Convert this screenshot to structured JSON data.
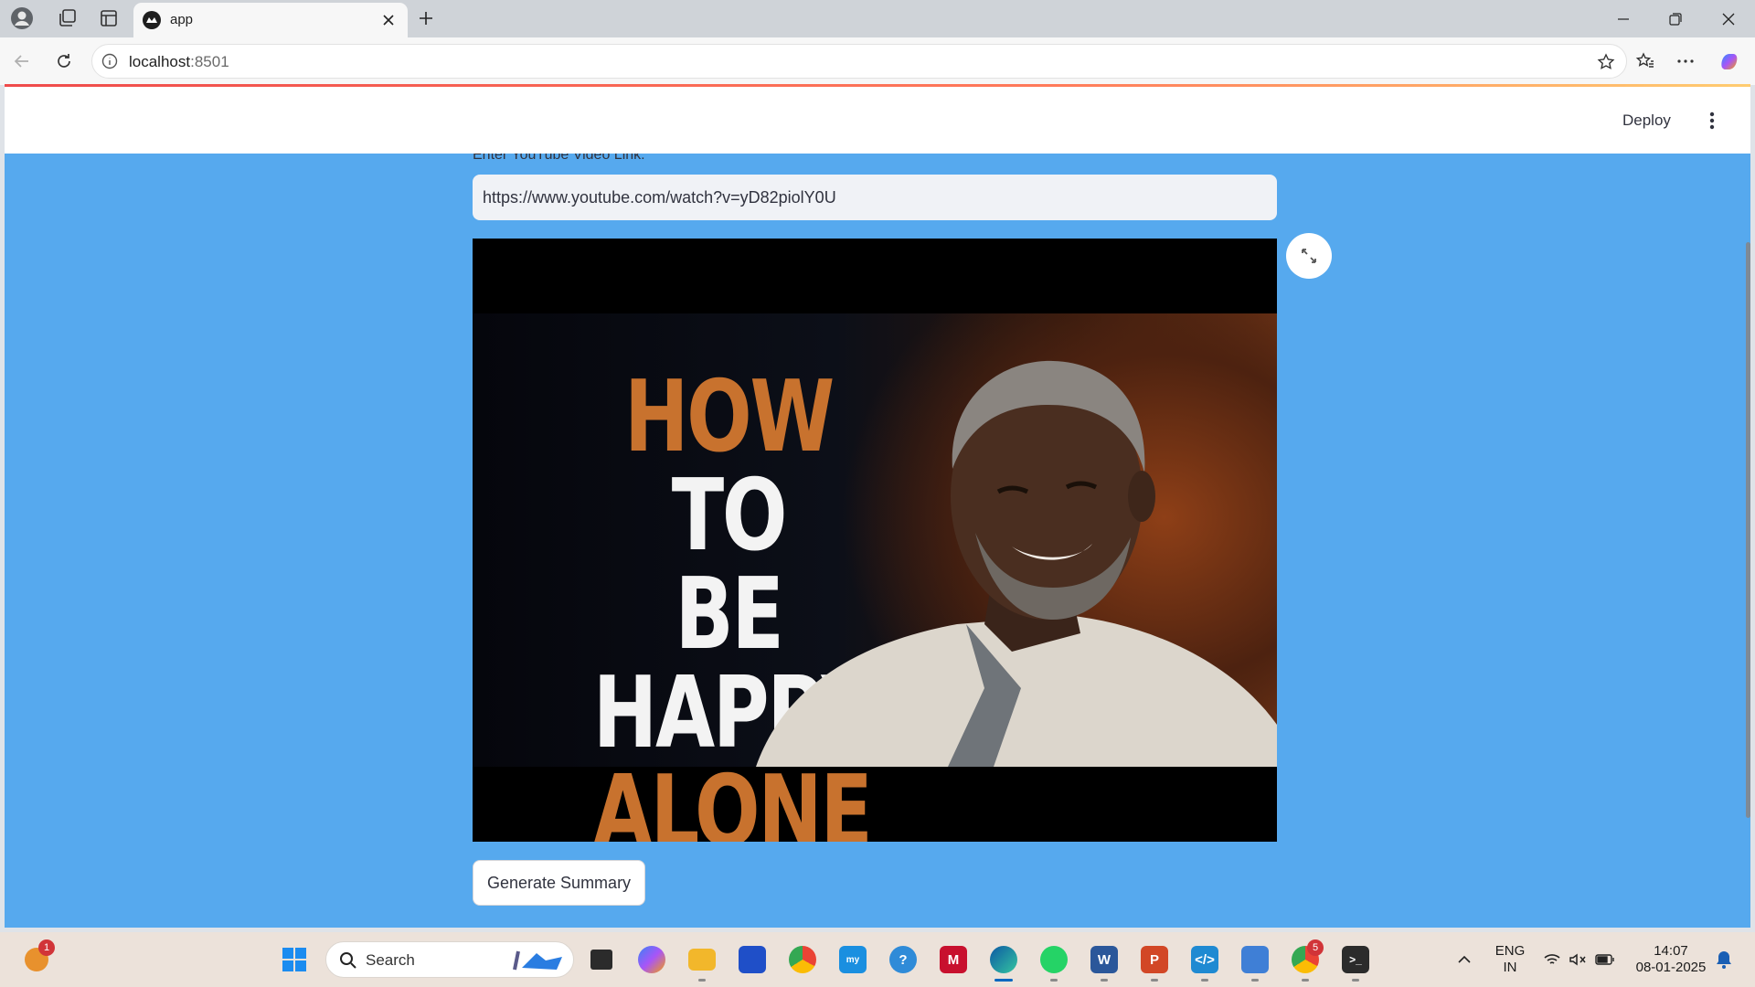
{
  "browser": {
    "tab_title": "app",
    "url_host": "localhost",
    "url_port": ":8501"
  },
  "app": {
    "header": {
      "deploy_label": "Deploy"
    },
    "input": {
      "label": "Enter YouTube Video Link:",
      "value": "https://www.youtube.com/watch?v=yD82piolY0U"
    },
    "video": {
      "headline": [
        "HOW",
        "TO",
        "BE HAPPY",
        "ALONE"
      ]
    },
    "button": {
      "label": "Generate Summary"
    }
  },
  "taskbar": {
    "search_label": "Search",
    "weather_badge": "1",
    "chrome_badge": "5",
    "language": "ENG",
    "region": "IN",
    "time": "14:07",
    "date": "08-01-2025"
  }
}
